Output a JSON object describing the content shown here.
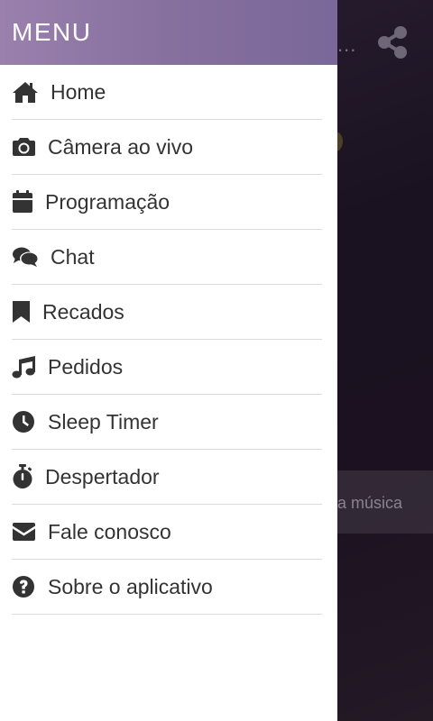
{
  "drawer": {
    "title": "MENU",
    "items": [
      {
        "label": "Home",
        "icon": "home-icon"
      },
      {
        "label": "Câmera ao vivo",
        "icon": "camera-icon"
      },
      {
        "label": "Programação",
        "icon": "calendar-icon"
      },
      {
        "label": "Chat",
        "icon": "chat-bubbles-icon"
      },
      {
        "label": "Recados",
        "icon": "bookmark-icon"
      },
      {
        "label": "Pedidos",
        "icon": "music-note-icon"
      },
      {
        "label": "Sleep Timer",
        "icon": "clock-icon"
      },
      {
        "label": "Despertador",
        "icon": "stopwatch-icon"
      },
      {
        "label": "Fale conosco",
        "icon": "envelope-icon"
      },
      {
        "label": "Sobre o aplicativo",
        "icon": "question-circle-icon"
      }
    ]
  },
  "background": {
    "player_text": "a música",
    "overflow_label": "..."
  },
  "colors": {
    "header_start": "#9a80ad",
    "header_end": "#7a689a",
    "text": "#333333",
    "divider": "#dcdcdc",
    "background_dark": "#1b1120"
  }
}
